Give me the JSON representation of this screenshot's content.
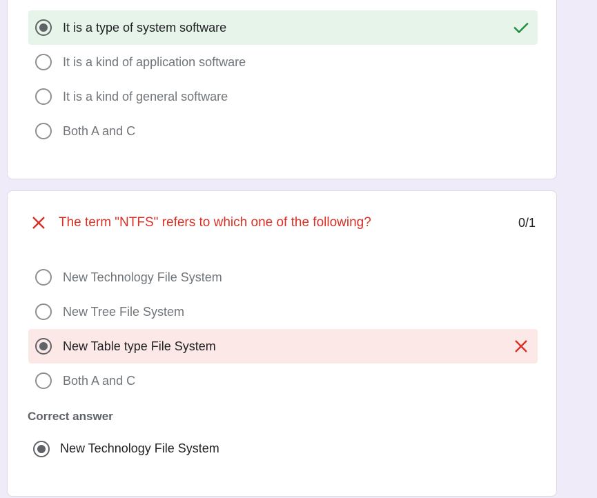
{
  "colors": {
    "page_background": "#f0ebf8",
    "correct_bg": "#e6f4ea",
    "correct_mark": "#1e8e3e",
    "wrong_bg": "#fce8e6",
    "wrong_mark": "#d93025"
  },
  "question1": {
    "options": [
      {
        "label": "It is a type of system software",
        "selected": true,
        "status": "correct",
        "icon": "check-icon"
      },
      {
        "label": "It is a kind of application software",
        "selected": false
      },
      {
        "label": "It is a kind of general software",
        "selected": false
      },
      {
        "label": "Both A and C",
        "selected": false
      }
    ]
  },
  "question2": {
    "status_icon": "close-icon",
    "title": "The term \"NTFS\" refers to which one of the following?",
    "score": "0/1",
    "options": [
      {
        "label": "New Technology File System",
        "selected": false
      },
      {
        "label": "New Tree File System",
        "selected": false
      },
      {
        "label": "New Table type File System",
        "selected": true,
        "status": "wrong",
        "icon": "close-icon"
      },
      {
        "label": "Both A and C",
        "selected": false
      }
    ],
    "correct_answer_label": "Correct answer",
    "correct_answer": "New Technology File System"
  }
}
